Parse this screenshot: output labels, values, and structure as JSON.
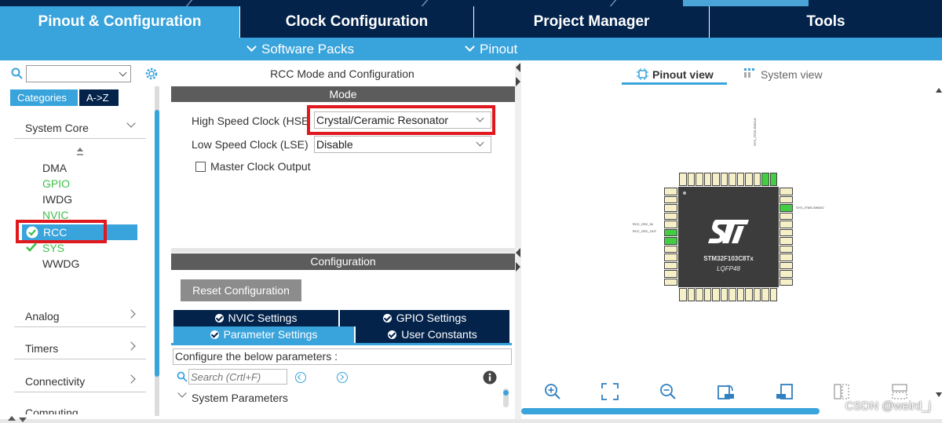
{
  "main_tabs": [
    {
      "label": "Pinout & Configuration",
      "active": true
    },
    {
      "label": "Clock Configuration",
      "active": false
    },
    {
      "label": "Project Manager",
      "active": false
    },
    {
      "label": "Tools",
      "active": false
    }
  ],
  "sub_nav": {
    "software_packs": "Software Packs",
    "pinout": "Pinout"
  },
  "left_panel": {
    "tabs": {
      "categories": "Categories",
      "az": "A->Z"
    },
    "system_core": {
      "label": "System Core",
      "items": [
        {
          "label": "DMA",
          "state": "normal"
        },
        {
          "label": "GPIO",
          "state": "green"
        },
        {
          "label": "IWDG",
          "state": "normal"
        },
        {
          "label": "NVIC",
          "state": "green"
        },
        {
          "label": "RCC",
          "state": "selected-checked"
        },
        {
          "label": "SYS",
          "state": "checked"
        },
        {
          "label": "WWDG",
          "state": "normal"
        }
      ]
    },
    "categories": [
      "Analog",
      "Timers",
      "Connectivity",
      "Computing"
    ]
  },
  "center_panel": {
    "title": "RCC Mode and Configuration",
    "mode_header": "Mode",
    "hse": {
      "label": "High Speed Clock (HSE)",
      "value": "Crystal/Ceramic Resonator"
    },
    "lse": {
      "label": "Low Speed Clock (LSE)",
      "value": "Disable"
    },
    "mco": {
      "label": "Master Clock Output",
      "checked": false
    },
    "config_header": "Configuration",
    "reset_button": "Reset Configuration",
    "config_tabs": [
      {
        "label": "NVIC Settings",
        "active": false
      },
      {
        "label": "GPIO Settings",
        "active": false
      },
      {
        "label": "Parameter Settings",
        "active": true
      },
      {
        "label": "User Constants",
        "active": false
      }
    ],
    "param_hint": "Configure the below parameters :",
    "search_placeholder": "Search (Crtl+F)",
    "group": "System Parameters"
  },
  "right_panel": {
    "views": {
      "pinout": "Pinout view",
      "system": "System view"
    },
    "chip": {
      "name": "STM32F103C8Tx",
      "package": "LQFP48"
    },
    "pin_labels": {
      "osc_in": "RCC_OSC_IN",
      "osc_out": "RCC_OSC_OUT",
      "swdio": "SYS_JTMS-SWDIO",
      "swclk": "SYS_JTCK-SWCLK"
    }
  },
  "colors": {
    "navy": "#03234b",
    "accent": "#39a3db",
    "highlight_red": "#e0191e",
    "ok_green": "#3ec14a"
  },
  "watermark": "CSDN @weird_j"
}
